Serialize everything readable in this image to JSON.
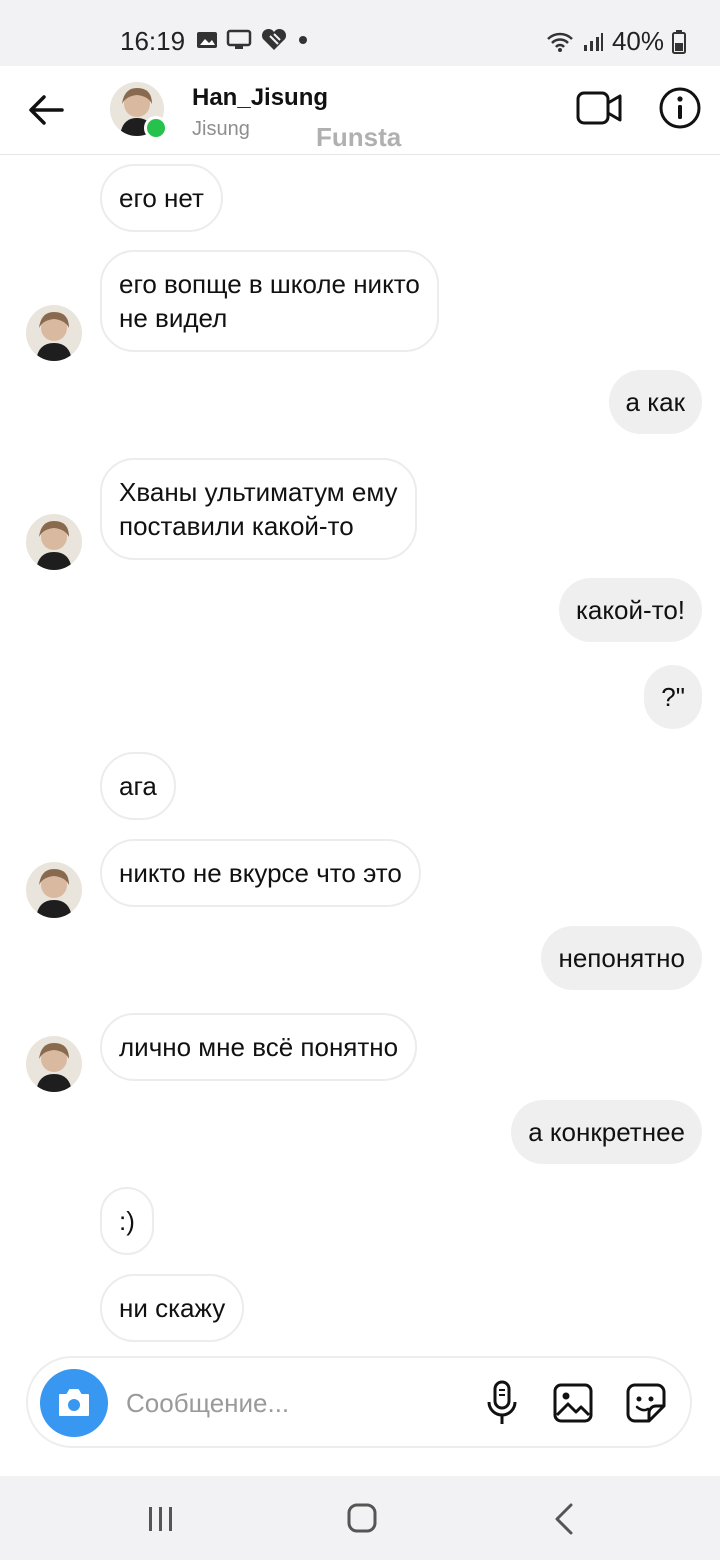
{
  "status_bar": {
    "time": "16:19",
    "battery": "40%"
  },
  "header": {
    "username": "Han_Jisung",
    "subtitle": "Jisung",
    "watermark": "Funsta"
  },
  "messages": [
    {
      "text": "его нет",
      "side": "in"
    },
    {
      "text": "его вопще в школе никто\nне видел",
      "side": "in"
    },
    {
      "text": "а как",
      "side": "out"
    },
    {
      "text": "Хваны ультиматум ему\nпоставили какой-то",
      "side": "in"
    },
    {
      "text": "какой-то!",
      "side": "out"
    },
    {
      "text": "?\"",
      "side": "out"
    },
    {
      "text": "ага",
      "side": "in"
    },
    {
      "text": "никто не вкурсе что это",
      "side": "in"
    },
    {
      "text": "непонятно",
      "side": "out"
    },
    {
      "text": "лично мне всё понятно",
      "side": "in"
    },
    {
      "text": "а конкретнее",
      "side": "out"
    },
    {
      "text": ":)",
      "side": "in"
    },
    {
      "text": "ни скажу",
      "side": "in"
    }
  ],
  "composer": {
    "placeholder": "Сообщение..."
  },
  "colors": {
    "accent": "#3897f0",
    "online": "#27c24c",
    "outgoing_bubble": "#efefef"
  },
  "icons": [
    "back-arrow-icon",
    "video-call-icon",
    "info-icon",
    "camera-icon",
    "microphone-icon",
    "gallery-icon",
    "sticker-icon",
    "recents-icon",
    "home-icon",
    "nav-back-icon"
  ]
}
